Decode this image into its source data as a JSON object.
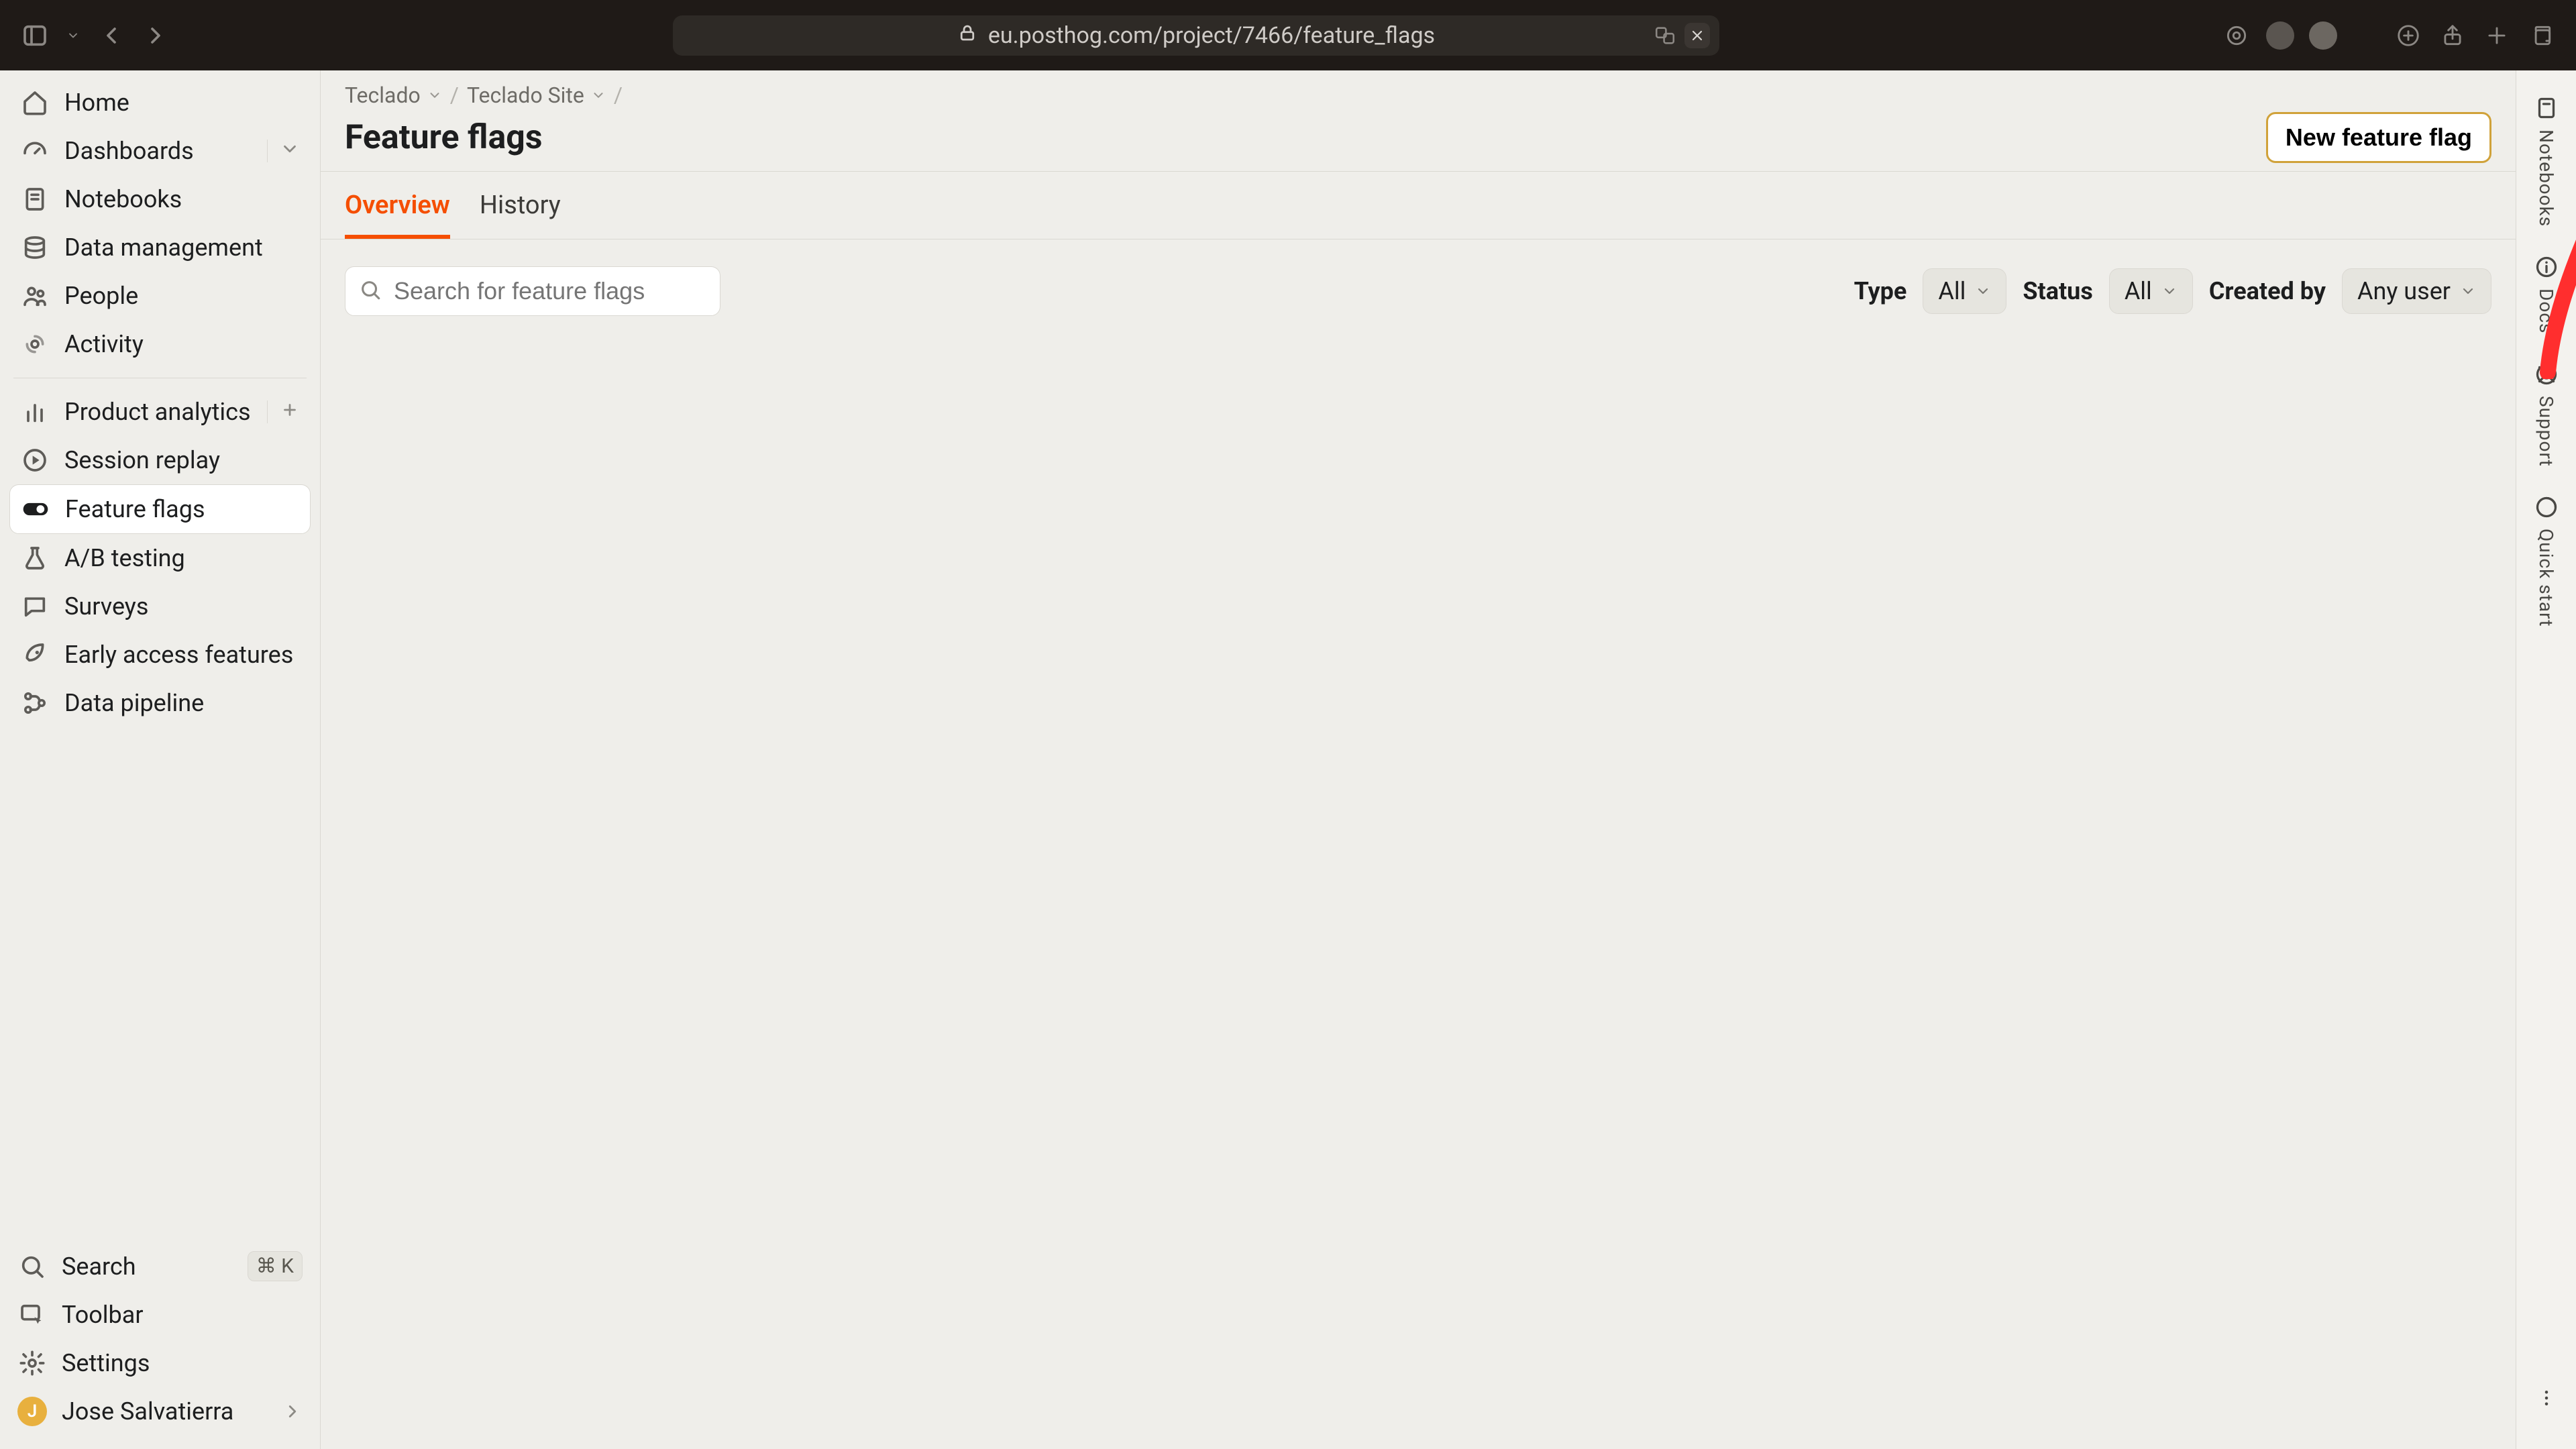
{
  "browser": {
    "url": "eu.posthog.com/project/7466/feature_flags"
  },
  "breadcrumbs": {
    "items": [
      {
        "label": "Teclado"
      },
      {
        "label": "Teclado Site"
      }
    ]
  },
  "page": {
    "title": "Feature flags",
    "new_button": "New feature flag"
  },
  "tabs": {
    "items": [
      {
        "label": "Overview",
        "active": true
      },
      {
        "label": "History",
        "active": false
      }
    ]
  },
  "search": {
    "placeholder": "Search for feature flags"
  },
  "filters": {
    "type": {
      "label": "Type",
      "value": "All"
    },
    "status": {
      "label": "Status",
      "value": "All"
    },
    "created_by": {
      "label": "Created by",
      "value": "Any user"
    }
  },
  "sidebar": {
    "top": [
      {
        "label": "Home"
      },
      {
        "label": "Dashboards",
        "expandable": true
      },
      {
        "label": "Notebooks"
      },
      {
        "label": "Data management"
      },
      {
        "label": "People"
      },
      {
        "label": "Activity"
      }
    ],
    "mid": [
      {
        "label": "Product analytics",
        "addable": true
      },
      {
        "label": "Session replay"
      },
      {
        "label": "Feature flags",
        "active": true
      },
      {
        "label": "A/B testing"
      },
      {
        "label": "Surveys"
      },
      {
        "label": "Early access features"
      },
      {
        "label": "Data pipeline"
      }
    ],
    "bottom": {
      "search": {
        "label": "Search",
        "shortcut": "⌘ K"
      },
      "toolbar": {
        "label": "Toolbar"
      },
      "settings": {
        "label": "Settings"
      },
      "user": {
        "name": "Jose Salvatierra",
        "initial": "J"
      }
    }
  },
  "right_rail": {
    "items": [
      {
        "label": "Notebooks"
      },
      {
        "label": "Docs"
      },
      {
        "label": "Support"
      },
      {
        "label": "Quick start"
      }
    ]
  }
}
